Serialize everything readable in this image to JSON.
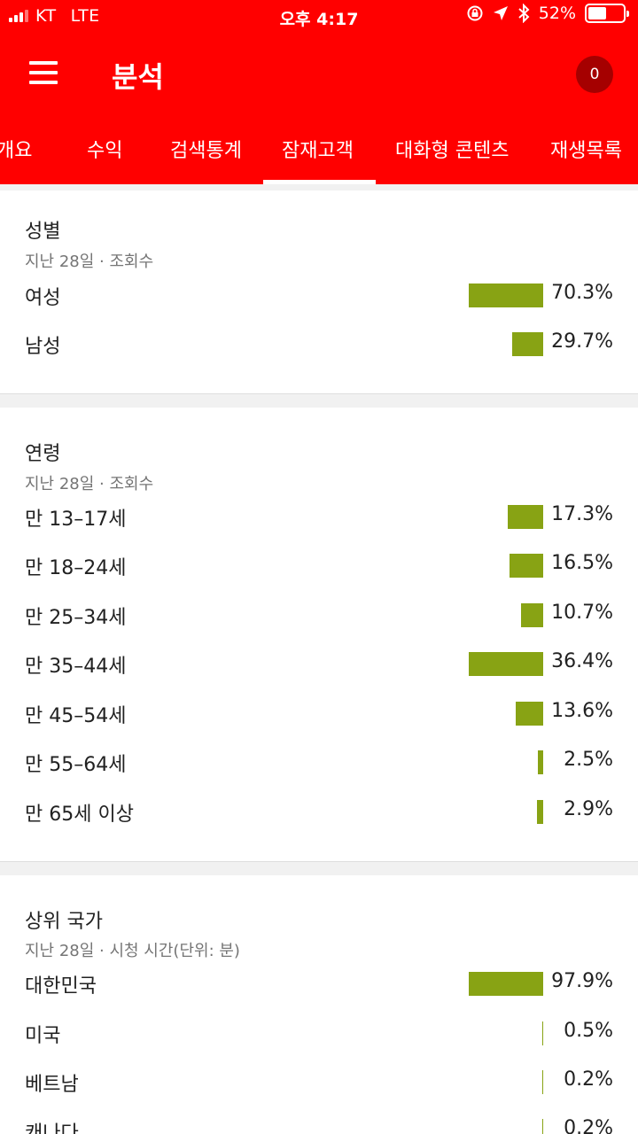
{
  "status_bar": {
    "carrier": "KT",
    "network": "LTE",
    "time": "오후 4:17",
    "battery": "52%",
    "battery_level": 0.52
  },
  "toolbar": {
    "title": "분석",
    "notification_count": "0"
  },
  "tabs": [
    {
      "label": "개요"
    },
    {
      "label": "수익"
    },
    {
      "label": "검색통계"
    },
    {
      "label": "잠재고객",
      "active": true
    },
    {
      "label": "대화형 콘텐츠"
    },
    {
      "label": "재생목록"
    }
  ],
  "accent_color": "#ff0000",
  "bar_color": "#88a314",
  "sections": {
    "gender": {
      "title": "성별",
      "subtitle": "지난 28일 · 조회수",
      "rows": [
        {
          "label": "여성",
          "value": "70.3%",
          "fraction": 0.703
        },
        {
          "label": "남성",
          "value": "29.7%",
          "fraction": 0.297
        }
      ]
    },
    "age": {
      "title": "연령",
      "subtitle": "지난 28일 · 조회수",
      "rows": [
        {
          "label": "만 13–17세",
          "value": "17.3%",
          "fraction": 0.173
        },
        {
          "label": "만 18–24세",
          "value": "16.5%",
          "fraction": 0.165
        },
        {
          "label": "만 25–34세",
          "value": "10.7%",
          "fraction": 0.107
        },
        {
          "label": "만 35–44세",
          "value": "36.4%",
          "fraction": 0.364
        },
        {
          "label": "만 45–54세",
          "value": "13.6%",
          "fraction": 0.136
        },
        {
          "label": "만 55–64세",
          "value": "2.5%",
          "fraction": 0.025
        },
        {
          "label": "만 65세 이상",
          "value": "2.9%",
          "fraction": 0.029
        }
      ]
    },
    "countries": {
      "title": "상위 국가",
      "subtitle": "지난 28일 · 시청 시간(단위: 분)",
      "rows": [
        {
          "label": "대한민국",
          "value": "97.9%",
          "fraction": 0.979
        },
        {
          "label": "미국",
          "value": "0.5%",
          "fraction": 0.005
        },
        {
          "label": "베트남",
          "value": "0.2%",
          "fraction": 0.002
        },
        {
          "label": "캐나다",
          "value": "0.2%",
          "fraction": 0.002
        }
      ]
    }
  }
}
